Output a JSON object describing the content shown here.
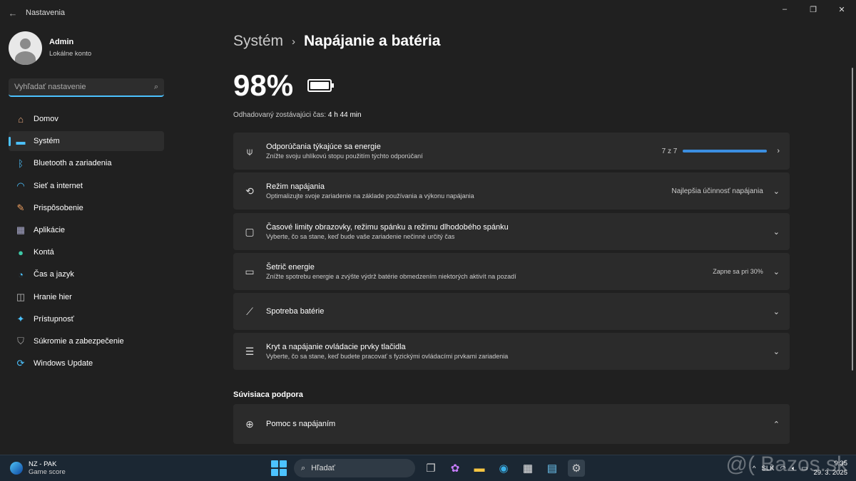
{
  "window": {
    "title": "Nastavenia",
    "back": "←",
    "minimize": "–",
    "maximize": "❐",
    "close": "✕"
  },
  "profile": {
    "name": "Admin",
    "account": "Lokálne konto"
  },
  "search": {
    "placeholder": "Vyhľadať nastavenie",
    "icon": "search-icon"
  },
  "sidebar": {
    "items": [
      {
        "label": "Domov",
        "icon": "home-icon",
        "glyph": "⌂",
        "color": "#e8a87c"
      },
      {
        "label": "Systém",
        "icon": "system-icon",
        "glyph": "▬",
        "color": "#4cc2ff",
        "active": true
      },
      {
        "label": "Bluetooth a zariadenia",
        "icon": "bluetooth-icon",
        "glyph": "ᛒ",
        "color": "#4cc2ff"
      },
      {
        "label": "Sieť a internet",
        "icon": "wifi-icon",
        "glyph": "◠",
        "color": "#4cc2ff"
      },
      {
        "label": "Prispôsobenie",
        "icon": "brush-icon",
        "glyph": "✎",
        "color": "#f0a060"
      },
      {
        "label": "Aplikácie",
        "icon": "apps-icon",
        "glyph": "▦",
        "color": "#aac"
      },
      {
        "label": "Kontá",
        "icon": "account-icon",
        "glyph": "●",
        "color": "#3ec9a7"
      },
      {
        "label": "Čas a jazyk",
        "icon": "clock-globe-icon",
        "glyph": "◔",
        "color": "#4cc2ff"
      },
      {
        "label": "Hranie hier",
        "icon": "gamepad-icon",
        "glyph": "◫",
        "color": "#bbb"
      },
      {
        "label": "Prístupnosť",
        "icon": "accessibility-icon",
        "glyph": "✦",
        "color": "#4cc2ff"
      },
      {
        "label": "Súkromie a zabezpečenie",
        "icon": "shield-icon",
        "glyph": "⛉",
        "color": "#aaa"
      },
      {
        "label": "Windows Update",
        "icon": "update-icon",
        "glyph": "⟳",
        "color": "#4cc2ff"
      }
    ]
  },
  "header": {
    "parent": "Systém",
    "separator": "›",
    "current": "Napájanie a batéria"
  },
  "battery": {
    "percent_label": "98%",
    "level": 0.98,
    "estimate_label": "Odhadovaný zostávajúci čas:",
    "estimate_value": "4 h 44 min"
  },
  "cards": [
    {
      "title": "Odporúčania týkajúce sa energie",
      "subtitle": "Znížte svoju uhlíkovú stopu použitím týchto odporúčaní",
      "icon": "leaf-icon",
      "glyph": "⍦",
      "right": "7 z 7",
      "progress": 1.0,
      "chevron": "›"
    },
    {
      "title": "Režim napájania",
      "subtitle": "Optimalizujte svoje zariadenie na základe používania a výkonu napájania",
      "icon": "power-mode-icon",
      "glyph": "⟲",
      "right": "Najlepšia účinnosť napájania",
      "chevron": "⌄"
    },
    {
      "title": "Časové limity obrazovky, režimu spánku a režimu dlhodobého spánku",
      "subtitle": "Vyberte, čo sa stane, keď bude vaše zariadenie nečinné určitý čas",
      "icon": "screen-sleep-icon",
      "glyph": "▢",
      "right": "",
      "chevron": "⌄"
    },
    {
      "title": "Šetrič energie",
      "subtitle": "Znížte spotrebu energie a zvýšte výdrž batérie obmedzením niektorých aktivít na pozadí",
      "icon": "battery-saver-icon",
      "glyph": "▭",
      "right": "Zapne sa pri 30%",
      "chevron": "⌄"
    },
    {
      "title": "Spotreba batérie",
      "subtitle": "",
      "icon": "chart-icon",
      "glyph": "⟋",
      "right": "",
      "chevron": "⌄"
    },
    {
      "title": "Kryt a napájanie ovládacie prvky tlačidla",
      "subtitle": "Vyberte, čo sa stane, keď budete pracovať s fyzickými ovládacími prvkami zariadenia",
      "icon": "list-icon",
      "glyph": "☰",
      "right": "",
      "chevron": "⌄"
    }
  ],
  "related": {
    "heading": "Súvisiaca podpora",
    "help": {
      "title": "Pomoc s napájaním",
      "icon": "globe-icon",
      "glyph": "⊕",
      "chevron": "⌃"
    }
  },
  "taskbar": {
    "weather_title": "NZ - PAK",
    "weather_sub": "Game score",
    "search": "Hľadať",
    "lang": "SLK",
    "time": "9:35",
    "date": "29. 3. 2025",
    "watermark": "@( Bazos.sk"
  }
}
